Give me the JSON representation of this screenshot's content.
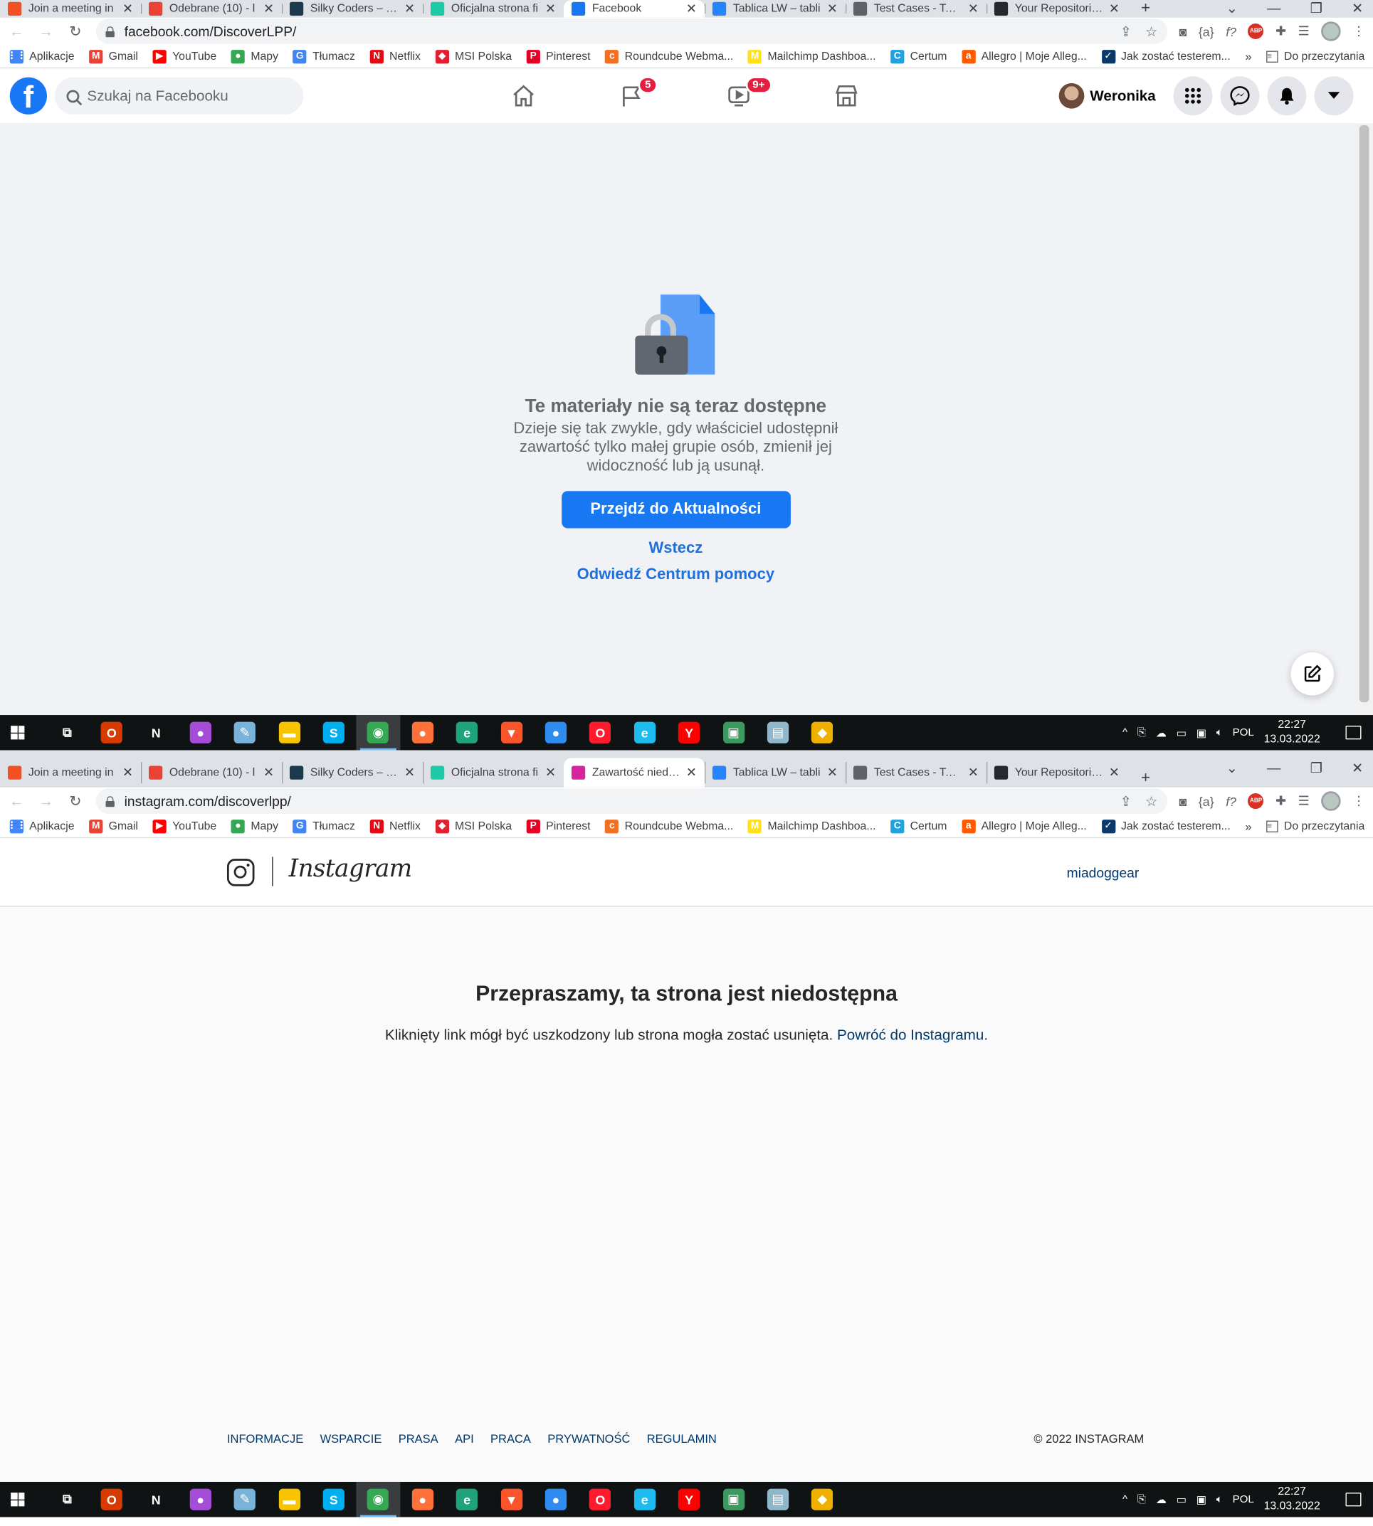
{
  "tabs": [
    {
      "title": "Join a meeting in",
      "icon": "microsoft-icon",
      "color": "#f25022"
    },
    {
      "title": "Odebrane (10) - l",
      "icon": "gmail-icon",
      "color": "#ea4335"
    },
    {
      "title": "Silky Coders – Ofi",
      "icon": "silky-icon",
      "color": "#1b3a4b"
    },
    {
      "title": "Oficjalna strona fi",
      "icon": "shirt-icon",
      "color": "#1ec9a8"
    },
    {
      "title": "Facebook",
      "icon": "facebook-icon",
      "color": "#1877f2"
    },
    {
      "title": "Tablica LW – tabli",
      "icon": "jira-icon",
      "color": "#2684ff"
    },
    {
      "title": "Test Cases - TestR",
      "icon": "globe-icon",
      "color": "#5f6368"
    },
    {
      "title": "Your Repositories",
      "icon": "github-icon",
      "color": "#24292e"
    }
  ],
  "tabs2": [
    {
      "title": "Join a meeting in",
      "icon": "microsoft-icon",
      "color": "#f25022"
    },
    {
      "title": "Odebrane (10) - l",
      "icon": "gmail-icon",
      "color": "#ea4335"
    },
    {
      "title": "Silky Coders – Ofi",
      "icon": "silky-icon",
      "color": "#1b3a4b"
    },
    {
      "title": "Oficjalna strona fi",
      "icon": "shirt-icon",
      "color": "#1ec9a8"
    },
    {
      "title": "Zawartość niedos",
      "icon": "instagram-icon",
      "color": "#d6249f"
    },
    {
      "title": "Tablica LW – tabli",
      "icon": "jira-icon",
      "color": "#2684ff"
    },
    {
      "title": "Test Cases - TestR",
      "icon": "globe-icon",
      "color": "#5f6368"
    },
    {
      "title": "Your Repositories",
      "icon": "github-icon",
      "color": "#24292e"
    }
  ],
  "window1": {
    "url": "facebook.com/DiscoverLPP/"
  },
  "window2": {
    "url": "instagram.com/discoverlpp/"
  },
  "bookmarks": [
    {
      "label": "Aplikacje",
      "icon": "apps-grid-icon",
      "color": "#4285f4",
      "glyph": "⋮⋮"
    },
    {
      "label": "Gmail",
      "icon": "gmail-icon",
      "color": "#ea4335",
      "glyph": "M"
    },
    {
      "label": "YouTube",
      "icon": "youtube-icon",
      "color": "#ff0000",
      "glyph": "▶"
    },
    {
      "label": "Mapy",
      "icon": "maps-pin-icon",
      "color": "#34a853",
      "glyph": "●"
    },
    {
      "label": "Tłumacz",
      "icon": "translate-icon",
      "color": "#4285f4",
      "glyph": "G"
    },
    {
      "label": "Netflix",
      "icon": "netflix-icon",
      "color": "#e50914",
      "glyph": "N"
    },
    {
      "label": "MSI Polska",
      "icon": "msi-shield-icon",
      "color": "#e0202e",
      "glyph": "◆"
    },
    {
      "label": "Pinterest",
      "icon": "pinterest-icon",
      "color": "#e60023",
      "glyph": "P"
    },
    {
      "label": "Roundcube Webma...",
      "icon": "roundcube-icon",
      "color": "#f36f21",
      "glyph": "c"
    },
    {
      "label": "Mailchimp Dashboa...",
      "icon": "mailchimp-icon",
      "color": "#ffe01b",
      "glyph": "M"
    },
    {
      "label": "Certum",
      "icon": "certum-icon",
      "color": "#1fa3e0",
      "glyph": "C"
    },
    {
      "label": "Allegro | Moje Alleg...",
      "icon": "allegro-icon",
      "color": "#ff5a00",
      "glyph": "a"
    },
    {
      "label": "Jak zostać testerem...",
      "icon": "checkbox-icon",
      "color": "#0b3a6a",
      "glyph": "✓"
    }
  ],
  "bookmarks_more": "»",
  "reading_list": "Do przeczytania",
  "facebook": {
    "search_placeholder": "Szukaj na Facebooku",
    "badges": {
      "pages": "5",
      "watch": "9+"
    },
    "user_name": "Weronika",
    "title": "Te materiały nie są teraz dostępne",
    "description": "Dzieje się tak zwykle, gdy właściciel udostępnił zawartość tylko małej grupie osób, zmienił jej widoczność lub ją usunął.",
    "primary_button": "Przejdź do Aktualności",
    "back_link": "Wstecz",
    "help_link": "Odwiedź Centrum pomocy"
  },
  "taskbar": {
    "lang": "POL",
    "time": "22:27",
    "date": "13.03.2022",
    "apps": [
      {
        "icon": "task-view-icon",
        "color": "#101314",
        "glyph": "⧉"
      },
      {
        "icon": "office-icon",
        "color": "#d83b01",
        "glyph": "O"
      },
      {
        "icon": "notion-n-icon",
        "color": "#101314",
        "glyph": "N"
      },
      {
        "icon": "drop-app-icon",
        "color": "#a54dd9",
        "glyph": "●"
      },
      {
        "icon": "paint-icon",
        "color": "#7ab3d9",
        "glyph": "✎"
      },
      {
        "icon": "file-explorer-icon",
        "color": "#f8c300",
        "glyph": "▬"
      },
      {
        "icon": "skype-icon",
        "color": "#00aff0",
        "glyph": "S"
      },
      {
        "icon": "chrome-icon",
        "color": "#34a853",
        "glyph": "◉"
      },
      {
        "icon": "firefox-icon",
        "color": "#ff7139",
        "glyph": "●"
      },
      {
        "icon": "edge-icon",
        "color": "#1fa37a",
        "glyph": "e"
      },
      {
        "icon": "brave-icon",
        "color": "#fb542b",
        "glyph": "▼"
      },
      {
        "icon": "firefox-dev-icon",
        "color": "#2e8cf0",
        "glyph": "●"
      },
      {
        "icon": "opera-icon",
        "color": "#ff1b2d",
        "glyph": "O"
      },
      {
        "icon": "ie-icon",
        "color": "#1ebbee",
        "glyph": "e"
      },
      {
        "icon": "yandex-icon",
        "color": "#ff0000",
        "glyph": "Y"
      },
      {
        "icon": "app-installer-icon",
        "color": "#3c9a5f",
        "glyph": "▣"
      },
      {
        "icon": "notes-icon",
        "color": "#8fb7c9",
        "glyph": "▤"
      },
      {
        "icon": "git-icon",
        "color": "#f0b000",
        "glyph": "◆"
      }
    ],
    "active_index": 7
  },
  "instagram": {
    "wordmark": "Instagram",
    "username": "miadoggear",
    "title": "Przepraszamy, ta strona jest niedostępna",
    "description": "Kliknięty link mógł być uszkodzony lub strona mogła zostać usunięta.",
    "back_link": "Powróć do Instagramu.",
    "footer_links": [
      "INFORMACJE",
      "WSPARCIE",
      "PRASA",
      "API",
      "PRACA",
      "PRYWATNOŚĆ",
      "REGULAMIN"
    ],
    "copyright": "© 2022 INSTAGRAM"
  }
}
